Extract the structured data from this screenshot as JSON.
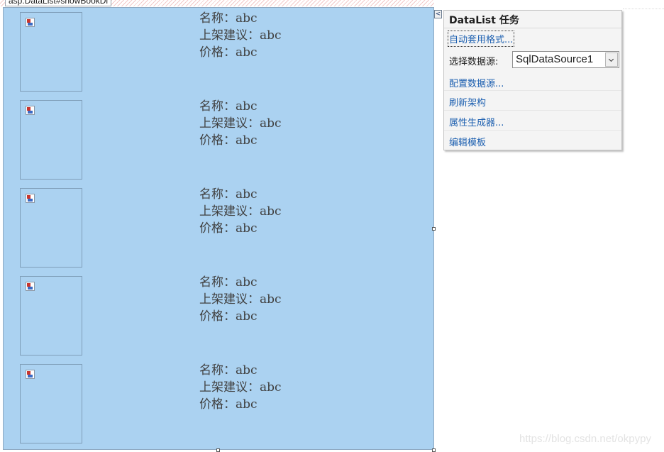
{
  "designer": {
    "control_tag": "asp:DataList#showBookDl"
  },
  "datalist": {
    "items": [
      {
        "name_line": "名称：abc",
        "suggest_line": "上架建议：abc",
        "price_line": "价格：abc"
      },
      {
        "name_line": "名称：abc",
        "suggest_line": "上架建议：abc",
        "price_line": "价格：abc"
      },
      {
        "name_line": "名称：abc",
        "suggest_line": "上架建议：abc",
        "price_line": "价格：abc"
      },
      {
        "name_line": "名称：abc",
        "suggest_line": "上架建议：abc",
        "price_line": "价格：abc"
      },
      {
        "name_line": "名称：abc",
        "suggest_line": "上架建议：abc",
        "price_line": "价格：abc"
      }
    ]
  },
  "smart_tag": {
    "button_glyph": "<",
    "title": "DataList 任务",
    "auto_format": "自动套用格式...",
    "datasource_label": "选择数据源:",
    "datasource_value": "SqlDataSource1",
    "configure": "配置数据源...",
    "refresh_schema": "刷新架构",
    "property_builder": "属性生成器...",
    "edit_templates": "编辑模板"
  },
  "watermark": "https://blog.csdn.net/okpypy",
  "colors": {
    "datalist_background": "#abd2f1",
    "link": "#1c5fb0"
  }
}
